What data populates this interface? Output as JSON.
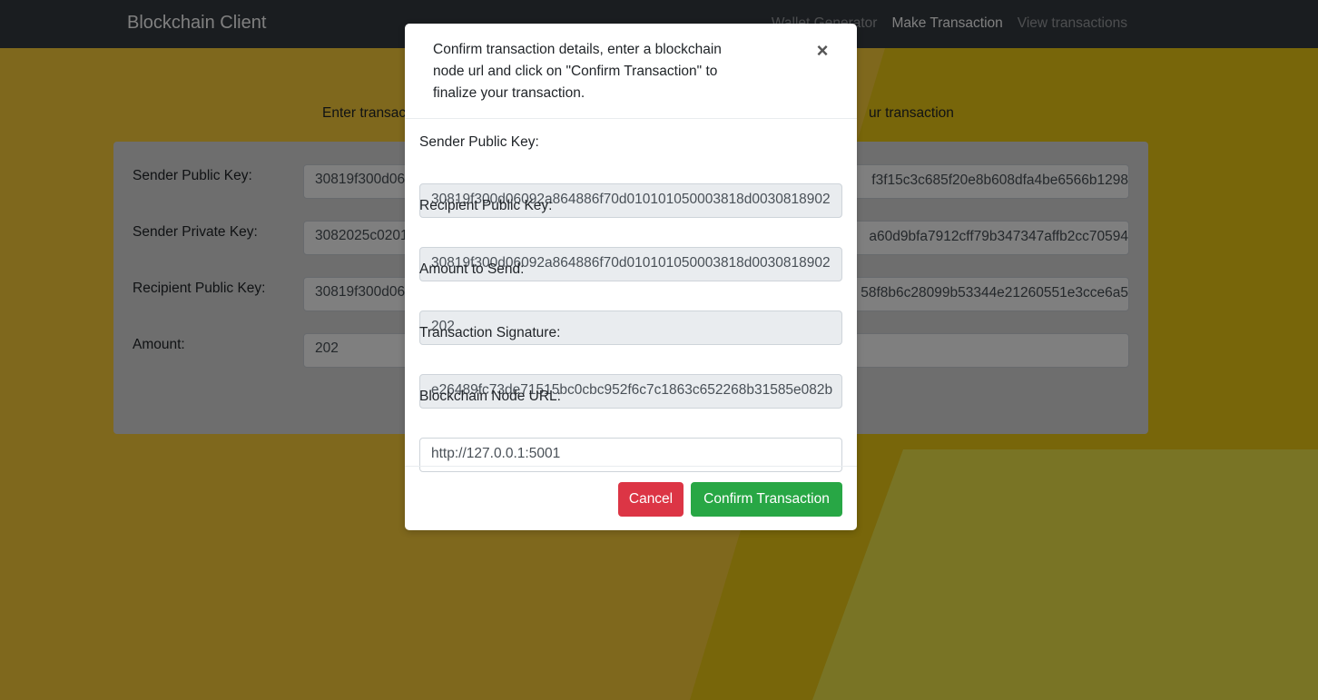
{
  "navbar": {
    "brand": "Blockchain Client",
    "links": [
      "Wallet Generator",
      "Make Transaction",
      "View transactions"
    ]
  },
  "page": {
    "intro_left": "Enter transac",
    "intro_right": "ur transaction",
    "form": {
      "sender_public_key": {
        "label": "Sender Public Key:",
        "left": "30819f300d06",
        "right": "f3f15c3c685f20e8b608dfa4be6566b1298"
      },
      "sender_private_key": {
        "label": "Sender Private Key:",
        "left": "3082025c0201",
        "right": "a60d9bfa7912cff79b347347affb2cc70594"
      },
      "recipient_public_key": {
        "label": "Recipient Public Key:",
        "left": "30819f300d06",
        "right": "58f8b6c28099b53344e21260551e3cce6a5"
      },
      "amount": {
        "label": "Amount:",
        "left": "202",
        "right": ""
      }
    }
  },
  "modal": {
    "title": "Confirm transaction details, enter a blockchain node url and click on \"Confirm Transaction\" to finalize your transaction.",
    "close_symbol": "×",
    "fields": {
      "sender_public_key": {
        "label": "Sender Public Key:",
        "value": "30819f300d06092a864886f70d010101050003818d0030818902"
      },
      "recipient_public_key": {
        "label": "Recipient Public Key:",
        "value": "30819f300d06092a864886f70d010101050003818d0030818902"
      },
      "amount": {
        "label": "Amount to Send:",
        "value": "202"
      },
      "signature": {
        "label": "Transaction Signature:",
        "value": "e26489fc73de71515bc0cbc952f6c7c1863c652268b31585e082b"
      },
      "node_url": {
        "label": "Blockchain Node URL:",
        "value": "http://127.0.0.1:5001"
      }
    },
    "buttons": {
      "cancel": "Cancel",
      "confirm": "Confirm Transaction"
    }
  },
  "colors": {
    "navbar": "#343a40",
    "background": "#f0cc14",
    "cancel": "#dc3545",
    "confirm": "#28a745"
  }
}
